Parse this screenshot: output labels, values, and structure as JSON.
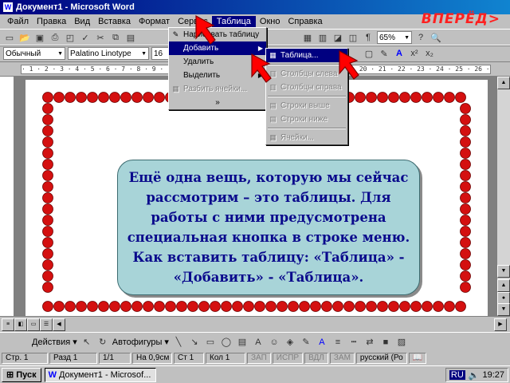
{
  "window": {
    "title": "Документ1 - Microsoft Word"
  },
  "menubar": {
    "items": [
      "Файл",
      "Правка",
      "Вид",
      "Вставка",
      "Формат",
      "Сервис",
      "Таблица",
      "Окно",
      "Справка"
    ],
    "active": "Таблица"
  },
  "nav": {
    "next_label": "ВПЕРЁД>"
  },
  "toolbar_standard": {
    "zoom": "65%"
  },
  "toolbar_format": {
    "style": "Обычный",
    "font": "Palatino Linotype",
    "size": "16"
  },
  "ruler_text": "· 1 · 2 · 3 · 4 · 5 · 6 · 7 · 8 · 9 · 10 · 11 · 12 · 13 · 14 · 15 · 16 · 17 · 18 · 19 · 20 · 21 · 22 · 23 · 24 · 25 · 26 · 27 ·",
  "table_menu": {
    "items": [
      {
        "label": "Нарисовать таблицу",
        "state": "normal"
      },
      {
        "label": "Добавить",
        "state": "highlighted",
        "submenu": true
      },
      {
        "label": "Удалить",
        "state": "normal",
        "submenu": true
      },
      {
        "label": "Выделить",
        "state": "normal",
        "submenu": true
      },
      {
        "label": "Разбить ячейки...",
        "state": "disabled"
      }
    ],
    "more": "»"
  },
  "insert_submenu": {
    "items": [
      {
        "label": "Таблица...",
        "state": "highlighted"
      },
      {
        "label": "Столбцы слева",
        "state": "disabled"
      },
      {
        "label": "Столбцы справа",
        "state": "disabled"
      },
      {
        "label": "Строки выше",
        "state": "disabled"
      },
      {
        "label": "Строки ниже",
        "state": "disabled"
      },
      {
        "label": "Ячейки...",
        "state": "disabled"
      }
    ]
  },
  "callout": {
    "text": "Ещё одна вещь, которую мы сейчас рассмотрим – это таблицы. Для работы с ними предусмотрена специальная кнопка в строке меню. Как вставить таблицу: «Таблица» - «Добавить» - «Таблица»."
  },
  "drawing_toolbar": {
    "actions_label": "Действия",
    "autoshapes_label": "Автофигуры"
  },
  "statusbar": {
    "page": "Стр. 1",
    "section": "Разд 1",
    "pages": "1/1",
    "position": "На 0,9см",
    "line": "Ст 1",
    "column": "Кол 1",
    "rec": "ЗАП",
    "trk": "ИСПР",
    "ext": "ВДЛ",
    "ovr": "ЗАМ",
    "language": "русский (Ро"
  },
  "taskbar": {
    "start_label": "Пуск",
    "task_label": "Документ1 - Microsof...",
    "lang": "RU",
    "clock": "19:27"
  },
  "colors": {
    "title_start": "#000080",
    "title_end": "#1084d0",
    "callout_bg": "#a8d4d8",
    "callout_text": "#0a0a8c",
    "border_apple": "#d41010",
    "arrow": "#ff0000",
    "next": "#ff2020"
  }
}
